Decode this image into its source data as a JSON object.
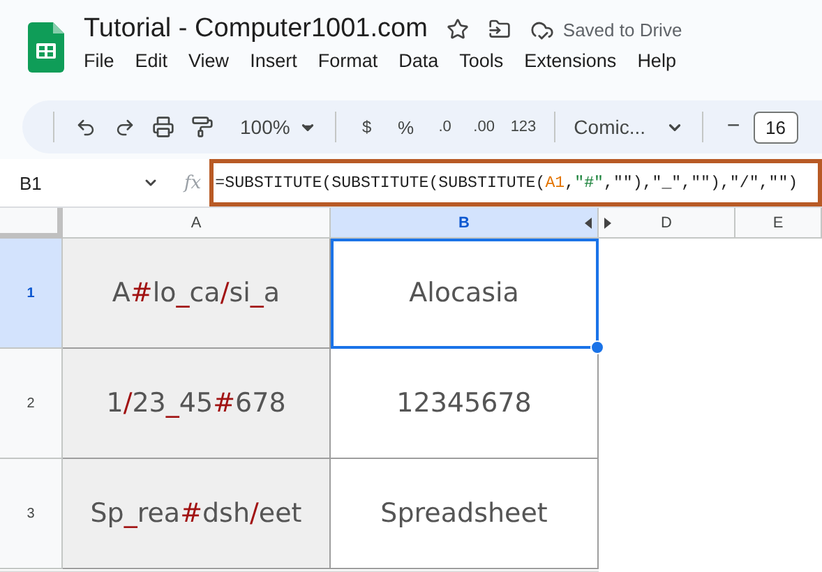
{
  "document": {
    "title": "Tutorial - Computer1001.com",
    "save_status": "Saved to Drive"
  },
  "menu": [
    "File",
    "Edit",
    "View",
    "Insert",
    "Format",
    "Data",
    "Tools",
    "Extensions",
    "Help"
  ],
  "toolbar": {
    "zoom": "100%",
    "currency": "$",
    "percent": "%",
    "decrease_decimal": ".0",
    "increase_decimal": ".00",
    "format": "123",
    "font": "Comic...",
    "minus": "−",
    "font_size": "16"
  },
  "formula_bar": {
    "name_box": "B1",
    "fx": "fx",
    "segments": [
      {
        "kind": "plain",
        "text": "=SUBSTITUTE(SUBSTITUTE(SUBSTITUTE("
      },
      {
        "kind": "ref",
        "text": "A1"
      },
      {
        "kind": "plain",
        "text": ","
      },
      {
        "kind": "string",
        "text": "\"#\""
      },
      {
        "kind": "plain",
        "text": ",\"\"),\"_\",\"\"),\"/\",\"\")"
      }
    ]
  },
  "columns": [
    {
      "label": "A",
      "selected": false
    },
    {
      "label": "B",
      "selected": true
    },
    {
      "label": "D",
      "selected": false
    },
    {
      "label": "E",
      "selected": false
    }
  ],
  "rows": [
    {
      "label": "1",
      "selected": true,
      "source": [
        {
          "text": "A",
          "mark": false
        },
        {
          "text": "#",
          "mark": true
        },
        {
          "text": "lo",
          "mark": false
        },
        {
          "text": "_",
          "mark": true
        },
        {
          "text": "ca",
          "mark": false
        },
        {
          "text": "/",
          "mark": true
        },
        {
          "text": "si",
          "mark": false
        },
        {
          "text": "_",
          "mark": true
        },
        {
          "text": "a",
          "mark": false
        }
      ],
      "result": "Alocasia",
      "result_selected": true
    },
    {
      "label": "2",
      "selected": false,
      "source": [
        {
          "text": "1",
          "mark": false
        },
        {
          "text": "/",
          "mark": true
        },
        {
          "text": "23",
          "mark": false
        },
        {
          "text": "_",
          "mark": true
        },
        {
          "text": "45",
          "mark": false
        },
        {
          "text": "#",
          "mark": true
        },
        {
          "text": "678",
          "mark": false
        }
      ],
      "result": "12345678",
      "result_selected": false
    },
    {
      "label": "3",
      "selected": false,
      "source": [
        {
          "text": "Sp",
          "mark": false
        },
        {
          "text": "_",
          "mark": true
        },
        {
          "text": "rea",
          "mark": false
        },
        {
          "text": "#",
          "mark": true
        },
        {
          "text": "dsh",
          "mark": false
        },
        {
          "text": "/",
          "mark": true
        },
        {
          "text": "eet",
          "mark": false
        }
      ],
      "result": "Spreadsheet",
      "result_selected": false
    }
  ]
}
